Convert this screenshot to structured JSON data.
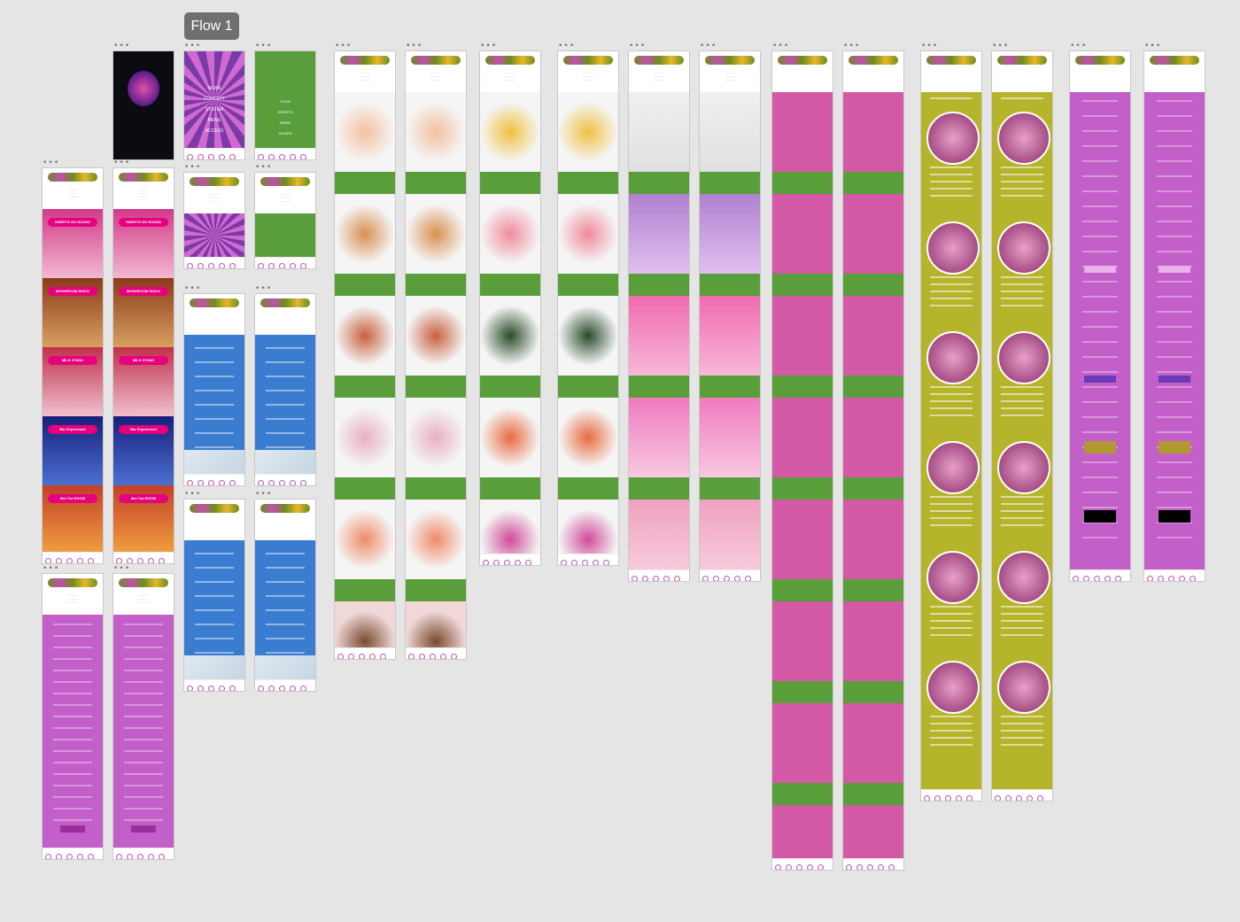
{
  "canvas": {
    "flow_label": "Flow 1",
    "background": "#e5e5e5"
  },
  "colors": {
    "green": "#5a9e3c",
    "purple": "#c25fc8",
    "pink": "#d55aa6",
    "olive": "#b5b42a",
    "blue": "#3a7ccf",
    "magenta": "#e6007e"
  },
  "hero_banners": [
    "SWEETS GO ROUND",
    "MUSHROOM DISCO",
    "MILK STAND",
    "Bar Experiment",
    "Mel-Tea ROOM"
  ],
  "nav_items": [
    "NEWS",
    "CONCEPT",
    "SYSTEM",
    "MENU",
    "ACCESS"
  ],
  "menu_items": [
    "FOOD",
    "SWEETS",
    "DRINK",
    "GOODS"
  ],
  "concept_heading": "CONCEPT",
  "system_heading": "SYSTEM"
}
